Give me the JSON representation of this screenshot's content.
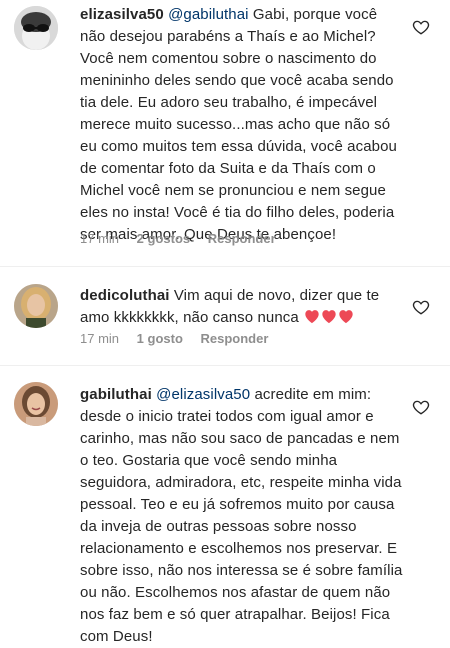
{
  "comments": [
    {
      "username": "elizasilva50",
      "mention": "@gabiluthai",
      "text": "Gabi, porque você não desejou parabéns a Thaís e ao Michel? Você nem comentou sobre o nascimento do menininho deles sendo que você acaba sendo tia dele. Eu adoro seu trabalho, é impecável merece muito sucesso...mas acho que não só eu como muitos tem essa dúvida, você acabou de comentar foto da Suita e da Thaís com o Michel você nem se pronunciou e nem segue eles no insta! Você é tia do filho deles, poderia ser mais amor. Que Deus te abençoe!",
      "time": "17 min",
      "likes": "2 gostos",
      "reply": "Responder",
      "avatar_icon": "sunglasses-person-avatar"
    },
    {
      "username": "dedicoluthai",
      "mention": "",
      "text": "Vim aqui de novo, dizer que te amo kkkkkkkk, não canso nunca",
      "emoji": "red-heart x3",
      "time": "17 min",
      "likes": "1 gosto",
      "reply": "Responder",
      "avatar_icon": "blonde-woman-avatar"
    },
    {
      "username": "gabiluthai",
      "mention": "@elizasilva50",
      "text": "acredite em mim: desde o inicio tratei todos com igual amor e carinho, mas não sou saco de pancadas e nem o teo. Gostaria que você sendo minha seguidora, admiradora, etc, respeite minha vida pessoal. Teo e eu já sofremos muito por causa da inveja de outras pessoas sobre nosso relacionamento e escolhemos nos preservar. E sobre isso, não nos interessa se é sobre família ou não. Escolhemos nos afastar de quem não nos faz bem e só quer atrapalhar. Beijos! Fica com Deus!",
      "avatar_icon": "smiling-woman-avatar"
    }
  ],
  "colors": {
    "heart": "#ed4956",
    "mention": "#003569",
    "meta": "#8e8e8e"
  }
}
